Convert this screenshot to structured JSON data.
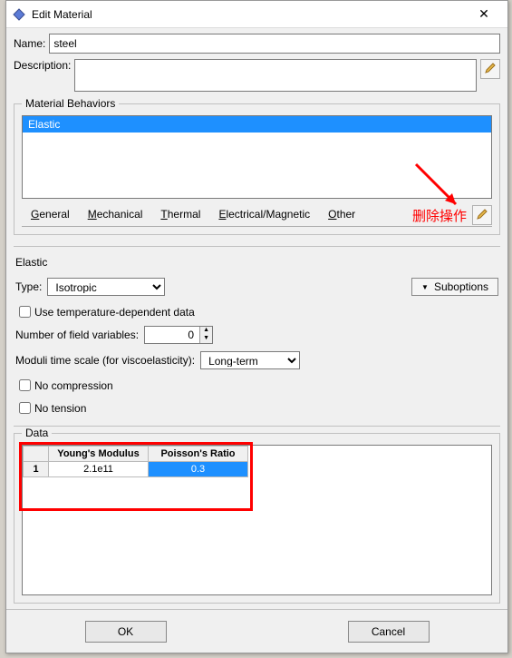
{
  "window": {
    "title": "Edit Material",
    "close_glyph": "✕"
  },
  "name_label": "Name:",
  "name_value": "steel",
  "description_label": "Description:",
  "description_value": "",
  "behaviors": {
    "legend": "Material Behaviors",
    "items": [
      "Elastic"
    ]
  },
  "menus": {
    "general": "General",
    "mechanical": "Mechanical",
    "thermal": "Thermal",
    "elmag": "Electrical/Magnetic",
    "other": "Other"
  },
  "annotation_text": "删除操作",
  "elastic": {
    "section_title": "Elastic",
    "type_label": "Type:",
    "type_value": "Isotropic",
    "suboptions_label": "Suboptions",
    "use_temp_label": "Use temperature-dependent data",
    "use_temp_checked": false,
    "numvars_label": "Number of field variables:",
    "numvars_value": 0,
    "moduli_label": "Moduli time scale (for viscoelasticity):",
    "moduli_value": "Long-term",
    "no_compression_label": "No compression",
    "no_compression_checked": false,
    "no_tension_label": "No tension",
    "no_tension_checked": false
  },
  "data": {
    "legend": "Data",
    "headers": [
      "Young's Modulus",
      "Poisson's Ratio"
    ],
    "rows": [
      {
        "idx": "1",
        "youngs": "2.1e11",
        "poisson": "0.3"
      }
    ]
  },
  "footer": {
    "ok": "OK",
    "cancel": "Cancel"
  },
  "icons": {
    "pencil": "✎",
    "app": "◆"
  }
}
